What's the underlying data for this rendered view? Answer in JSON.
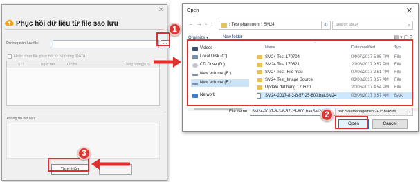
{
  "app": {
    "title": "Phục hồi dữ liệu từ file sao lưu",
    "path_label": "Đường dẫn lưu file:",
    "browse_label": "...",
    "checkbox_label": "Hoặc chọn file phục hồi từ hệ thống iDATA",
    "grid_columns": [
      "STT",
      "Ngày tạo",
      "Tên file",
      "Dung lượng(KB)"
    ],
    "info_label": "Thông tin dữ liệu",
    "run_button": "Thực hiện",
    "close_glyph": "✕"
  },
  "dialog": {
    "title": "Open",
    "close_glyph": "✕",
    "breadcrumb": [
      "Test phan mem",
      "SM24"
    ],
    "search_placeholder": "Search SM24",
    "toolbar": {
      "organize": "Organize ▾",
      "new_folder": "New folder"
    },
    "nav_items": [
      {
        "label": "Videos",
        "icon": "video-icon"
      },
      {
        "label": "Local Disk (C:)",
        "icon": "drive-icon"
      },
      {
        "label": "CD Drive (D:)",
        "icon": "cd-drive-icon"
      },
      {
        "label": "New Volume (E:)",
        "icon": "drive-icon"
      },
      {
        "label": "New Volume (F:)",
        "icon": "drive-icon"
      },
      {
        "label": "Network",
        "icon": "network-icon"
      }
    ],
    "columns": {
      "name": "Name",
      "date": "Date modified",
      "type": "Typ"
    },
    "files": [
      {
        "name": "SM24 Test 170704",
        "date": "04/07/2017 5:05 PM",
        "type": "File",
        "kind": "folder"
      },
      {
        "name": "SM24 Test 170821",
        "date": "21/08/2017 9:57 PM",
        "type": "File",
        "kind": "folder"
      },
      {
        "name": "SM24 Test_File mau",
        "date": "07/06/2017 2:51 PM",
        "type": "File",
        "kind": "folder"
      },
      {
        "name": "SM24 Test_Image Source",
        "date": "03/08/2017 8:57 AM",
        "type": "File",
        "kind": "folder"
      },
      {
        "name": "Update dat hang 170620",
        "date": "20/06/2017 4:54 PM",
        "type": "File",
        "kind": "folder"
      },
      {
        "name": "SM24-2017-8-3-8-57-25-800.bakSM24",
        "date": "03/08/2017 8:57 AM",
        "type": "BAK",
        "kind": "file"
      }
    ],
    "file_name_label": "File name:",
    "file_name_value": "SM24-2017-8-3-8-57-25-800.bakSM24",
    "file_type_value": "bak SaleManagement24 (*.bakSM",
    "open_button": "Open",
    "cancel_button": "Cancel"
  },
  "annotations": {
    "badge1": "1",
    "badge2": "2",
    "badge3": "3"
  },
  "colors": {
    "highlight": "#e0302e",
    "badge": "#d73a36",
    "selection": "#cce8ff",
    "accent": "#0078d7"
  }
}
